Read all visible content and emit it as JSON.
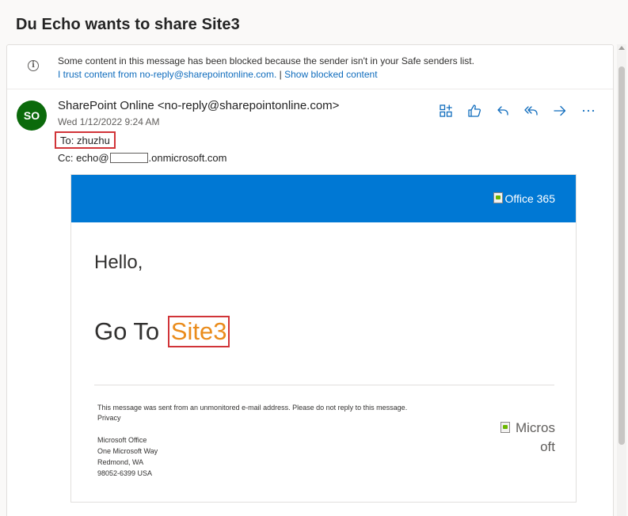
{
  "subject": "Du Echo wants to share Site3",
  "banner": {
    "message": "Some content in this message has been blocked because the sender isn't in your Safe senders list.",
    "trust_link": "I trust content from no-reply@sharepointonline.com.",
    "separator": "|",
    "show_blocked_link": "Show blocked content"
  },
  "header": {
    "avatar_initials": "SO",
    "avatar_color": "#0b6a0b",
    "sender": "SharePoint Online <no-reply@sharepointonline.com>",
    "date": "Wed 1/12/2022 9:24 AM",
    "to_label": "To:",
    "to_value": "zhuzhu",
    "cc_label": "Cc:",
    "cc_prefix": "echo@",
    "cc_suffix": ".onmicrosoft.com"
  },
  "actions": [
    {
      "name": "apps-icon"
    },
    {
      "name": "like-icon"
    },
    {
      "name": "reply-icon"
    },
    {
      "name": "reply-all-icon"
    },
    {
      "name": "forward-icon"
    },
    {
      "name": "more-icon"
    }
  ],
  "email": {
    "header_color": "#0078d4",
    "logo_alt": "Office 365",
    "greeting": "Hello,",
    "goto_prefix": "Go To",
    "site_link": "Site3",
    "link_color": "#ea8c1c",
    "footer_note": "This message was sent from an unmonitored e-mail address. Please do not reply to this message.",
    "privacy_link": "Privacy",
    "address_lines": [
      "Microsoft Office",
      "One Microsoft Way",
      "Redmond, WA",
      "98052-6399 USA"
    ],
    "ms_logo_alt_line1": "Micros",
    "ms_logo_alt_line2": "oft"
  }
}
